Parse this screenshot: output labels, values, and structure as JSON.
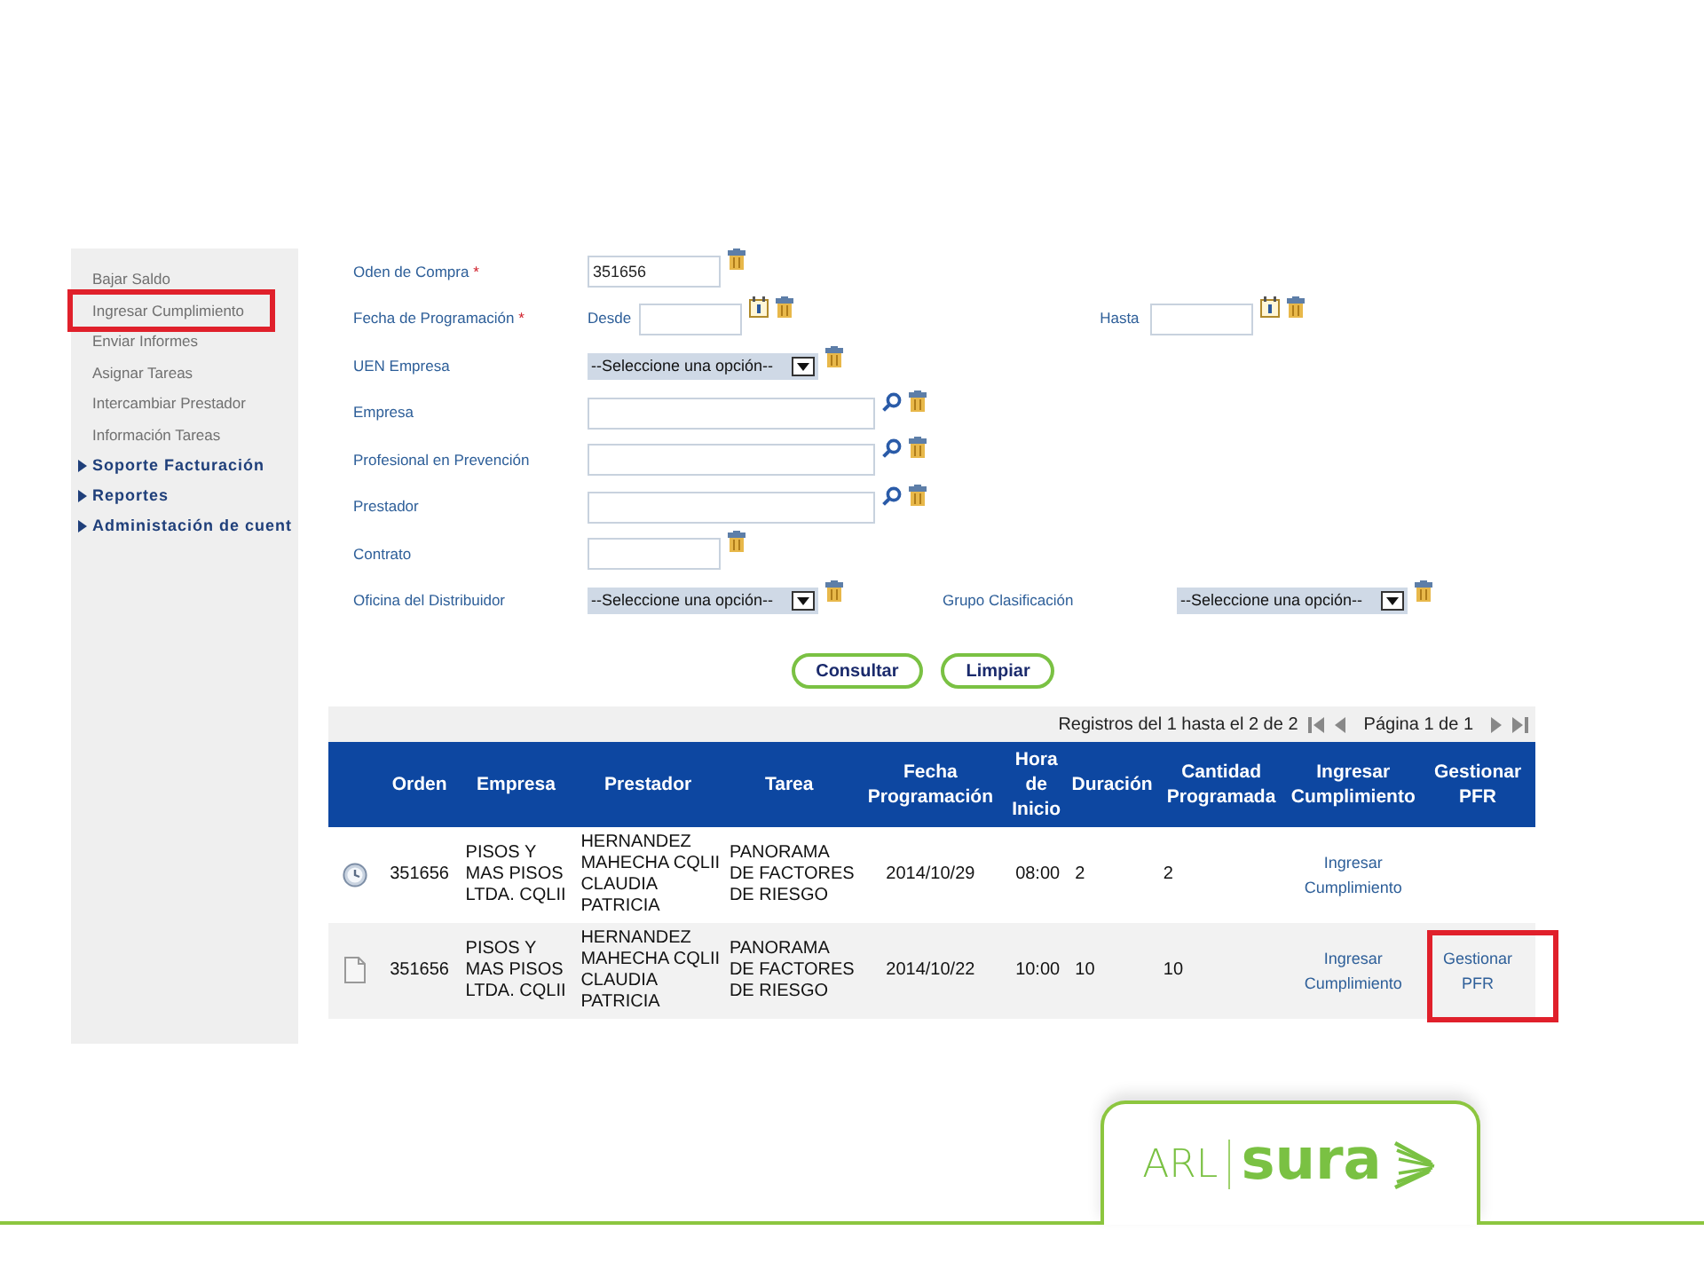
{
  "sidebar": {
    "items": [
      {
        "label": "Bajar Saldo",
        "kind": "link"
      },
      {
        "label": "Ingresar Cumplimiento",
        "kind": "link",
        "highlighted": true
      },
      {
        "label": "Enviar Informes",
        "kind": "link"
      },
      {
        "label": "Asignar Tareas",
        "kind": "link"
      },
      {
        "label": "Intercambiar Prestador",
        "kind": "link"
      },
      {
        "label": "Información Tareas",
        "kind": "link"
      },
      {
        "label": "Soporte Facturación",
        "kind": "section"
      },
      {
        "label": "Reportes",
        "kind": "section"
      },
      {
        "label": "Administación de cuent",
        "kind": "section"
      }
    ]
  },
  "form": {
    "fields": [
      {
        "label": "Oden de Compra",
        "marker": "*",
        "controls": [
          {
            "kind": "short-input",
            "value": "351656"
          }
        ]
      },
      {
        "label": "Fecha de Programación",
        "marker": "*",
        "controls": [
          {
            "kind": "date",
            "caption": "Desde"
          },
          {
            "kind": "date",
            "caption": "Hasta"
          }
        ]
      },
      {
        "label": "UEN Empresa",
        "controls": [
          {
            "kind": "select",
            "value": "--Seleccione una opción--"
          }
        ]
      },
      {
        "label": "Empresa",
        "controls": [
          {
            "kind": "lookup-input"
          }
        ]
      },
      {
        "label": "Profesional en Prevención",
        "controls": [
          {
            "kind": "lookup-input"
          }
        ]
      },
      {
        "label": "Prestador",
        "controls": [
          {
            "kind": "lookup-input"
          }
        ]
      },
      {
        "label": "Contrato",
        "controls": [
          {
            "kind": "short-input"
          }
        ]
      },
      {
        "label": "Oficina del Distribuidor",
        "controls": [
          {
            "kind": "select",
            "value": "--Seleccione una opción--"
          },
          {
            "kind": "select",
            "caption": "Grupo Clasificación",
            "value": "--Seleccione una opción--"
          }
        ]
      }
    ],
    "buttons": [
      "Consultar",
      "Limpiar"
    ]
  },
  "pager": {
    "summary": "Registros del 1 hasta el 2 de 2",
    "page": "Página 1 de 1"
  },
  "table": {
    "columns": [
      "Orden",
      "Empresa",
      "Prestador",
      "Tarea",
      "Fecha Programación",
      "Hora de Inicio",
      "Duración",
      "Cantidad Programada",
      "Ingresar Cumplimiento",
      "Gestionar PFR"
    ],
    "rows": [
      {
        "kind": "scheduled",
        "cells": [
          "351656",
          "PISOS Y MAS PISOS LTDA. CQLII",
          "HERNANDEZ MAHECHA CQLII CLAUDIA PATRICIA",
          "PANORAMA DE FACTORES DE RIESGO",
          "2014/10/29",
          "08:00",
          "2",
          "2"
        ],
        "ingresar": "Ingresar Cumplimiento"
      },
      {
        "kind": "documented",
        "cells": [
          "351656",
          "PISOS Y MAS PISOS LTDA. CQLII",
          "HERNANDEZ MAHECHA CQLII CLAUDIA PATRICIA",
          "PANORAMA DE FACTORES DE RIESGO",
          "2014/10/22",
          "10:00",
          "10",
          "10"
        ],
        "ingresar": "Ingresar Cumplimiento",
        "gestionar": "Gestionar PFR",
        "highlighted": true
      }
    ]
  },
  "logo": {
    "prefix": "ARL",
    "brand": "sura"
  }
}
